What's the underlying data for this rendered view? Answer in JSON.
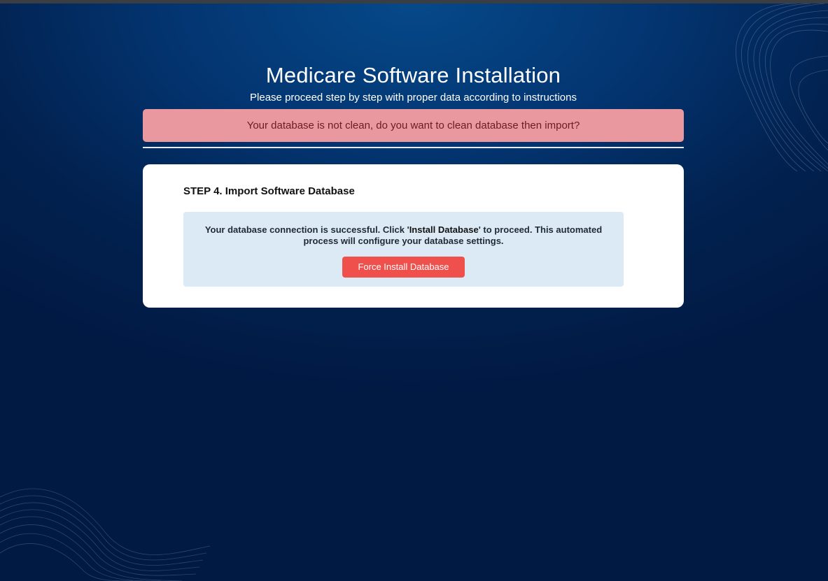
{
  "header": {
    "title": "Medicare Software Installation",
    "subtitle": "Please proceed step by step with proper data according to instructions"
  },
  "alert": {
    "message": "Your database is not clean, do you want to clean database then import?"
  },
  "step": {
    "title": "STEP 4. Import Software Database",
    "info_prefix": "Your database connection is successful. Click '",
    "info_strong": "Install Database",
    "info_suffix": "' to proceed. This automated process will configure your database settings.",
    "button_label": "Force Install Database"
  },
  "colors": {
    "background": "#02214f",
    "alert_bg": "#ea989f",
    "info_bg": "#dceaf5",
    "button_bg": "#f0504c"
  }
}
